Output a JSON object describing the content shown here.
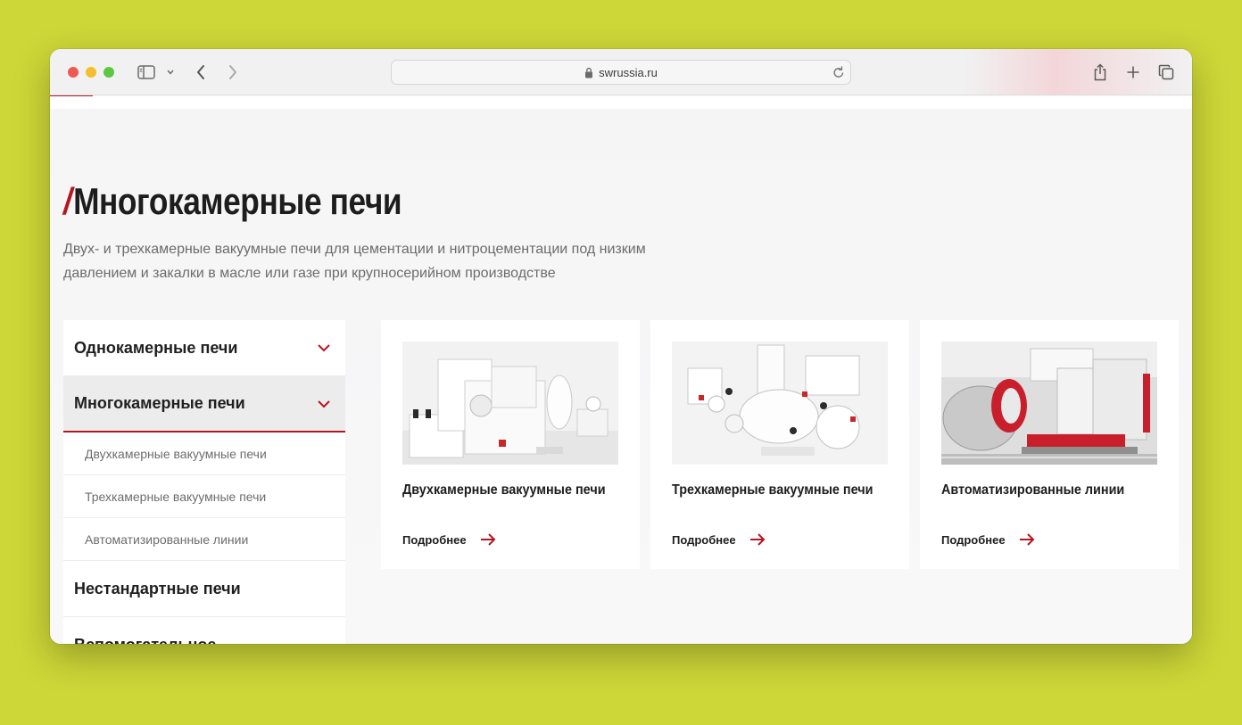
{
  "browser": {
    "url": "swrussia.ru"
  },
  "page": {
    "title_slash": "/",
    "title": "Многокамерные печи",
    "subtitle": "Двух- и трехкамерные вакуумные печи для цементации и нитроцементации под низким давлением и закалки в масле или газе при крупносерийном производстве"
  },
  "sidebar": {
    "items": [
      {
        "label": "Однокамерные печи"
      },
      {
        "label": "Многокамерные печи"
      },
      {
        "label": "Нестандартные печи"
      },
      {
        "label": "Вспомогательное"
      }
    ],
    "subitems": [
      {
        "label": "Двухкамерные вакуумные печи"
      },
      {
        "label": "Трехкамерные вакуумные печи"
      },
      {
        "label": "Автоматизированные линии"
      }
    ]
  },
  "cards": [
    {
      "title": "Двухкамерные вакуумные печи",
      "more": "Подробнее"
    },
    {
      "title": "Трехкамерные вакуумные печи",
      "more": "Подробнее"
    },
    {
      "title": "Автоматизированные линии",
      "more": "Подробнее"
    }
  ],
  "colors": {
    "accent": "#b51621",
    "background": "#cdd737"
  },
  "icons": [
    "sidebar-toggle-icon",
    "chevron-down-icon",
    "back-icon",
    "forward-icon",
    "lock-icon",
    "reload-icon",
    "share-icon",
    "plus-icon",
    "tabs-icon",
    "arrow-right-icon"
  ]
}
